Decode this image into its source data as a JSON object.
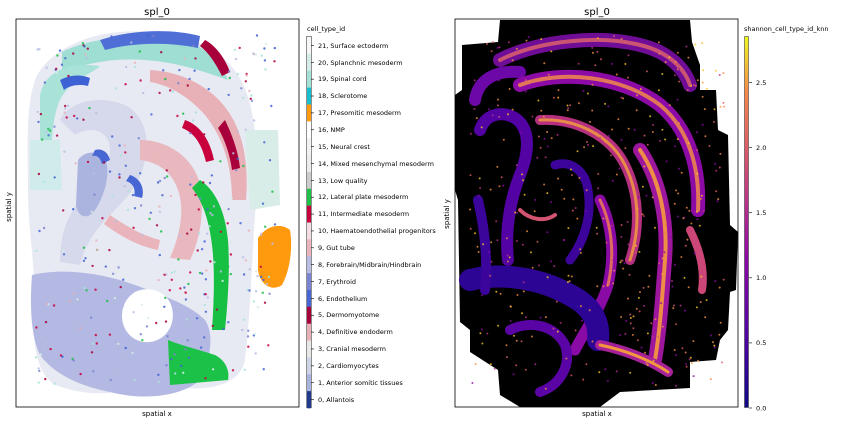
{
  "chart_data": [
    {
      "type": "scatter",
      "title": "spl_0",
      "xlabel": "spatial x",
      "ylabel": "spatial y",
      "legend": {
        "title": "cell_type_id",
        "placement": "right",
        "entries": [
          {
            "label": "21, Surface ectoderm",
            "color": "#f7f7f7"
          },
          {
            "label": "20, Splanchnic mesoderm",
            "color": "#d6ece8"
          },
          {
            "label": "19, Spinal cord",
            "color": "#a5e2d6"
          },
          {
            "label": "18, Sclerotome",
            "color": "#17becf"
          },
          {
            "label": "17, Presomitic mesoderm",
            "color": "#ff9a0e"
          },
          {
            "label": "16, NMP",
            "color": "#ffffff"
          },
          {
            "label": "15, Neural crest",
            "color": "#f2f2f2"
          },
          {
            "label": "14, Mixed mesenchymal mesoderm",
            "color": "#ececec"
          },
          {
            "label": "13, Low quality",
            "color": "#cccccc"
          },
          {
            "label": "12, Lateral plate mesoderm",
            "color": "#1fc146"
          },
          {
            "label": "11, Intermediate mesoderm",
            "color": "#c8003e"
          },
          {
            "label": "10, Haematoendothelial progenitors",
            "color": "#f4dde3"
          },
          {
            "label": "9, Gut tube",
            "color": "#e9b4bb"
          },
          {
            "label": "8, Forebrain/Midbrain/Hindbrain",
            "color": "#b9bde3"
          },
          {
            "label": "7, Erythroid",
            "color": "#7b84d2"
          },
          {
            "label": "6, Endothelium",
            "color": "#4866d4"
          },
          {
            "label": "5, Dermomyotome",
            "color": "#a8003a"
          },
          {
            "label": "4, Definitive endoderm",
            "color": "#e7b0b6"
          },
          {
            "label": "3, Cranial mesoderm",
            "color": "#e8e8e8"
          },
          {
            "label": "2, Cardiomyocytes",
            "color": "#cfd3e6"
          },
          {
            "label": "1, Anterior somitic tissues",
            "color": "#a9b4de"
          },
          {
            "label": "0, Allantois",
            "color": "#1f3a8f"
          }
        ]
      }
    },
    {
      "type": "scatter",
      "title": "spl_0",
      "xlabel": "spatial x",
      "ylabel": "spatial y",
      "colorbar": {
        "label": "shannon_cell_type_id_knn",
        "colormap": "plasma",
        "range": [
          0.0,
          2.85
        ],
        "ticks": [
          "0.0",
          "0.5",
          "1.0",
          "1.5",
          "2.0",
          "2.5"
        ],
        "tick_values": [
          0.0,
          0.5,
          1.0,
          1.5,
          2.0,
          2.5
        ]
      }
    }
  ]
}
